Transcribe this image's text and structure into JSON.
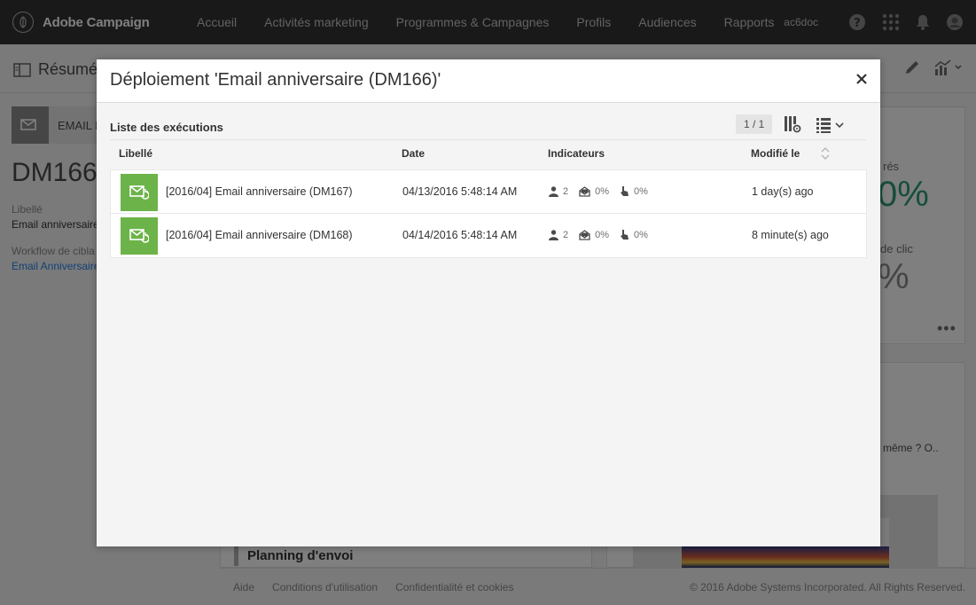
{
  "app": {
    "brand": "Adobe Campaign",
    "nav": [
      "Accueil",
      "Activités marketing",
      "Programmes & Campagnes",
      "Profils",
      "Audiences",
      "Rapports"
    ],
    "user": "ac6doc"
  },
  "page": {
    "title": "Résumé",
    "type_label": "EMAIL R",
    "code": "DM166",
    "libelle_label": "Libellé",
    "libelle_value": "Email anniversaire",
    "workflow_label": "Workflow de cibla",
    "workflow_link": "Email Anniversaire",
    "stat1_label": "rés",
    "stat1_value": "0%",
    "stat2_label": "de clic",
    "stat2_value": "%",
    "card2_text": "même ? O..",
    "planning_title": "Planning d'envoi"
  },
  "footer": {
    "links": [
      "Aide",
      "Conditions d'utilisation",
      "Confidentialité et cookies"
    ],
    "copyright": "© 2016 Adobe Systems Incorporated. All Rights Reserved."
  },
  "modal": {
    "title": "Déploiement 'Email anniversaire (DM166)'",
    "list_title": "Liste des exécutions",
    "pager": "1 / 1",
    "columns": {
      "label": "Libellé",
      "date": "Date",
      "indicators": "Indicateurs",
      "modified": "Modifié le"
    },
    "rows": [
      {
        "label": "[2016/04] Email anniversaire (DM167)",
        "date": "04/13/2016 5:48:14 AM",
        "recipients": "2",
        "opens": "0%",
        "clicks": "0%",
        "modified": "1 day(s) ago"
      },
      {
        "label": "[2016/04] Email anniversaire (DM168)",
        "date": "04/14/2016 5:48:14 AM",
        "recipients": "2",
        "opens": "0%",
        "clicks": "0%",
        "modified": "8 minute(s) ago"
      }
    ]
  },
  "colors": {
    "nav_bg": "#323232",
    "thumb_green": "#6cb34a",
    "link_blue": "#2680eb",
    "stat_green": "#2d9d78"
  }
}
